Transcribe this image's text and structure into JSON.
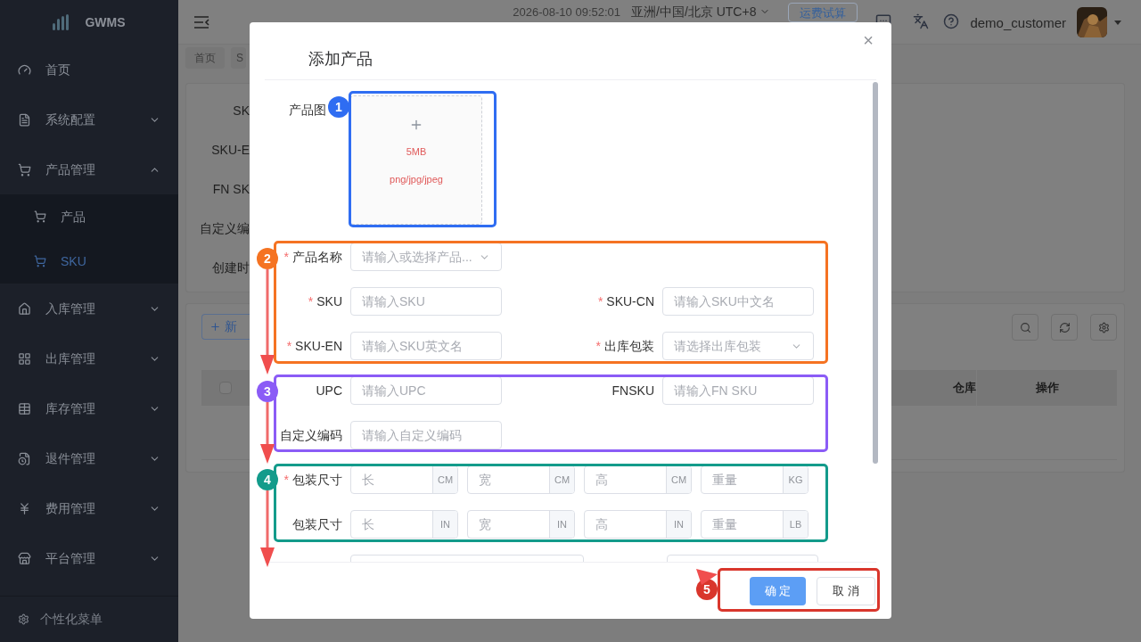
{
  "sidebar": {
    "logo": "GWMS",
    "items": [
      {
        "label": "首页",
        "kind": "link",
        "selected": false
      },
      {
        "label": "系统配置",
        "kind": "group",
        "expanded": false,
        "selected": false
      },
      {
        "label": "产品管理",
        "kind": "group",
        "expanded": true,
        "selected": false,
        "children": [
          {
            "label": "产品",
            "selected": false
          },
          {
            "label": "SKU",
            "selected": true
          }
        ]
      },
      {
        "label": "入库管理",
        "kind": "group",
        "expanded": false,
        "selected": false
      },
      {
        "label": "出库管理",
        "kind": "group",
        "expanded": false,
        "selected": false
      },
      {
        "label": "库存管理",
        "kind": "group",
        "expanded": false,
        "selected": false
      },
      {
        "label": "退件管理",
        "kind": "group",
        "expanded": false,
        "selected": false
      },
      {
        "label": "费用管理",
        "kind": "group",
        "expanded": false,
        "selected": false
      },
      {
        "label": "平台管理",
        "kind": "group",
        "expanded": false,
        "selected": false
      }
    ],
    "footer": "个性化菜单"
  },
  "header": {
    "datetime": "2026-08-10 09:52:01",
    "timezone": "亚洲/中国/北京 UTC+8",
    "freight_button": "运费试算",
    "username": "demo_customer"
  },
  "breadcrumb": [
    {
      "label": "首页"
    },
    {
      "label": "S"
    }
  ],
  "background": {
    "filter_labels": [
      "SK",
      "SKU-E",
      "FN SK",
      "自定义编",
      "创建时"
    ],
    "add_button": "新",
    "select_all_checked": false,
    "table_columns": [
      "仓库",
      "操作"
    ]
  },
  "dialog": {
    "title": "添加产品",
    "close": "×",
    "upload": {
      "label": "产品图",
      "size_hint": "5MB",
      "type_hint": "png/jpg/jpeg"
    },
    "rows": [
      [
        {
          "label": "产品名称",
          "required_mark": "*",
          "placeholder": "请输入或选择产品...",
          "kind": "select"
        }
      ],
      [
        {
          "label": "SKU",
          "required_mark": "*",
          "placeholder": "请输入SKU",
          "kind": "input"
        },
        {
          "label": "SKU-CN",
          "required_mark": "*",
          "placeholder": "请输入SKU中文名",
          "kind": "input"
        }
      ],
      [
        {
          "label": "SKU-EN",
          "required_mark": "*",
          "placeholder": "请输入SKU英文名",
          "kind": "input"
        },
        {
          "label": "出库包装",
          "required_mark": "*",
          "placeholder": "请选择出库包装",
          "kind": "select"
        }
      ],
      [
        {
          "label": "UPC",
          "placeholder": "请输入UPC",
          "kind": "input"
        },
        {
          "label": "FNSKU",
          "placeholder": "请输入FN SKU",
          "kind": "input"
        }
      ],
      [
        {
          "label": "自定义编码",
          "placeholder": "请输入自定义编码",
          "kind": "input"
        }
      ]
    ],
    "size_rows": [
      {
        "label": "包装尺寸",
        "required_mark": "*",
        "inputs": [
          {
            "placeholder": "长",
            "unit": "CM"
          },
          {
            "placeholder": "宽",
            "unit": "CM"
          },
          {
            "placeholder": "高",
            "unit": "CM"
          },
          {
            "placeholder": "重量",
            "unit": "KG"
          }
        ]
      },
      {
        "label": "包装尺寸",
        "inputs": [
          {
            "placeholder": "长",
            "unit": "IN"
          },
          {
            "placeholder": "宽",
            "unit": "IN"
          },
          {
            "placeholder": "高",
            "unit": "IN"
          },
          {
            "placeholder": "重量",
            "unit": "LB"
          }
        ]
      }
    ],
    "buttons": [
      {
        "label": "确 定",
        "kind": "primary"
      },
      {
        "label": "取 消",
        "kind": "default"
      }
    ]
  },
  "annotations": [
    {
      "label": "1",
      "color": "#2f6df2"
    },
    {
      "label": "2",
      "color": "#f57322"
    },
    {
      "label": "3",
      "color": "#8b5cf6"
    },
    {
      "label": "4",
      "color": "#139b8b"
    },
    {
      "label": "5",
      "color": "#d9362c"
    }
  ]
}
